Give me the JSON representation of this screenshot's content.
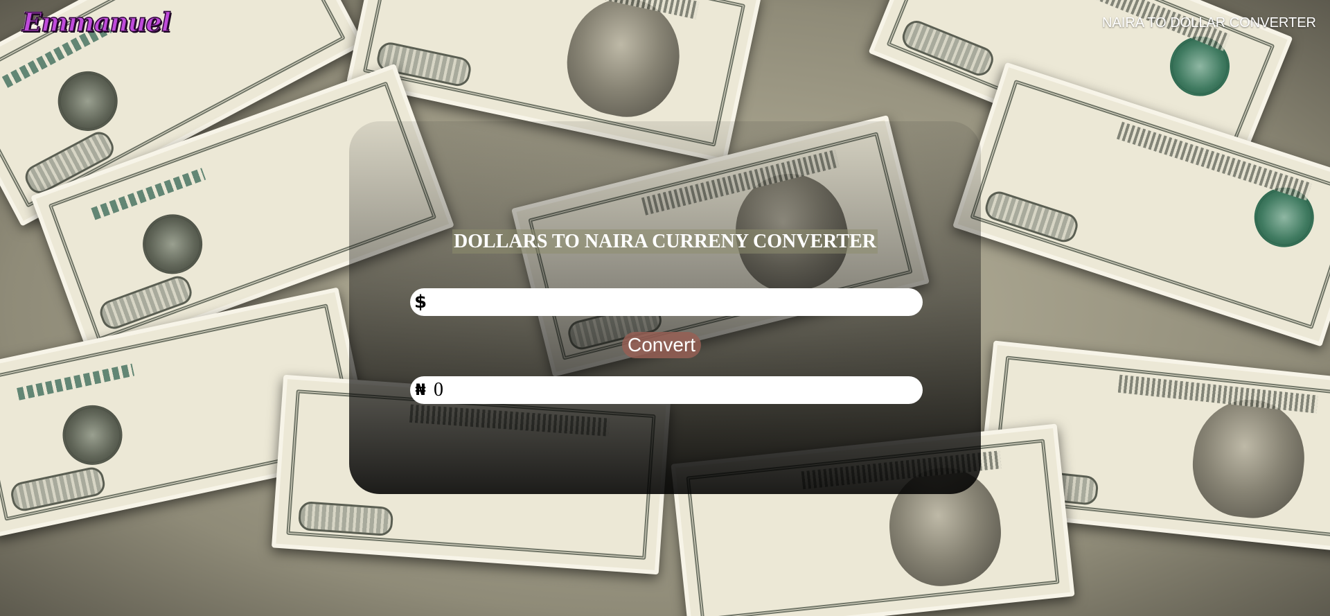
{
  "header": {
    "logo_text": "Emmanuel",
    "nav_title": "NAIRA TO DOLLAR CONVERTER"
  },
  "converter": {
    "title": "DOLLARS TO NAIRA CURRENY CONVERTER",
    "dollar_symbol": "$",
    "dollar_input_value": "",
    "convert_label": "Convert",
    "naira_symbol": "₦",
    "naira_result": "0"
  },
  "colors": {
    "logo": "#c04bdc",
    "convert_button": "#965f55",
    "card_overlay": "#000000",
    "title_highlight": "#8c8c6e"
  },
  "background": {
    "description_icon": "dollar-bills-background"
  }
}
